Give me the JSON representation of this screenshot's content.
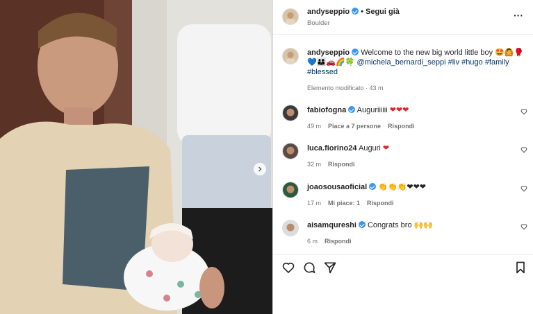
{
  "post": {
    "username": "andyseppio",
    "follow_label": "Segui già",
    "location": "Boulder",
    "caption_text": "Welcome to the new big world little boy",
    "caption_emojis_1": "🤩🙆🥊",
    "caption_emojis_2": "💙👨‍👩‍👦🚗🌈🍀",
    "caption_mention": "@michela_bernardi_seppi",
    "caption_tags": [
      "#liv",
      "#hugo",
      "#family",
      "#blessed"
    ],
    "edited": "Elemento modificato · 43 m"
  },
  "comments": [
    {
      "user": "fabiofogna",
      "verified": true,
      "text": "Auguriiiiii",
      "emojis": "❤❤❤",
      "time": "49 m",
      "likes": "Piace a 7 persone",
      "reply": "Rispondi"
    },
    {
      "user": "luca.fiorino24",
      "verified": false,
      "text": "Auguri",
      "emojis": "❤",
      "time": "32 m",
      "likes": "",
      "reply": "Rispondi"
    },
    {
      "user": "joaosousaoficial",
      "verified": true,
      "text": "",
      "emojis": "👏👏👏❤❤❤",
      "time": "17 m",
      "likes": "Mi piace: 1",
      "reply": "Rispondi"
    },
    {
      "user": "aisamqureshi",
      "verified": true,
      "text": "Congrats bro",
      "emojis": "🙌🙌",
      "time": "6 m",
      "likes": "",
      "reply": "Rispondi"
    }
  ],
  "icons": {
    "more": "more-options-icon",
    "like": "heart-icon",
    "comment": "comment-icon",
    "share": "send-icon",
    "save": "bookmark-icon",
    "next": "chevron-right-icon"
  },
  "colors": {
    "verified": "#3897f0",
    "tag": "#00376b",
    "meta": "#737373",
    "heart": "#e0242b"
  }
}
